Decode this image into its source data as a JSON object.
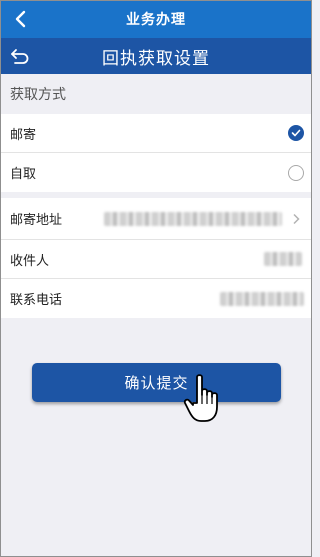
{
  "topbar": {
    "title": "业务办理",
    "back_icon": "chevron-left-icon"
  },
  "subbar": {
    "title": "回执获取设置",
    "back_icon": "return-arrow-icon"
  },
  "method_section": {
    "title": "获取方式",
    "options": [
      {
        "label": "邮寄",
        "selected": true
      },
      {
        "label": "自取",
        "selected": false
      }
    ]
  },
  "address_section": {
    "rows": [
      {
        "label": "邮寄地址",
        "value_obscured": true,
        "has_chevron": true
      },
      {
        "label": "收件人",
        "value_obscured": true,
        "has_chevron": false
      },
      {
        "label": "联系电话",
        "value_obscured": true,
        "has_chevron": false
      }
    ]
  },
  "confirm_button": {
    "label": "确认提交"
  },
  "colors": {
    "topbar": "#1a73c9",
    "subbar": "#1d55a5",
    "button": "#1d55a5",
    "background": "#efeff4"
  }
}
